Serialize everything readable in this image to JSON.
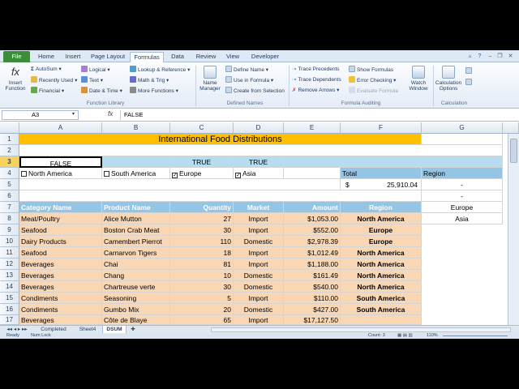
{
  "tabs": {
    "file": "File",
    "home": "Home",
    "insert": "Insert",
    "page_layout": "Page Layout",
    "formulas": "Formulas",
    "data": "Data",
    "review": "Review",
    "view": "View",
    "developer": "Developer"
  },
  "ribbon": {
    "insert_function": "Insert Function",
    "autosum": "AutoSum",
    "recently_used": "Recently Used",
    "financial": "Financial",
    "logical": "Logical",
    "text": "Text",
    "date_time": "Date & Time",
    "lookup_reference": "Lookup & Reference",
    "math_trig": "Math & Trig",
    "more_functions": "More Functions",
    "function_library": "Function Library",
    "name_manager": "Name Manager",
    "define_name": "Define Name",
    "use_in_formula": "Use in Formula",
    "create_from_selection": "Create from Selection",
    "defined_names": "Defined Names",
    "trace_precedents": "Trace Precedents",
    "trace_dependents": "Trace Dependents",
    "remove_arrows": "Remove Arrows",
    "show_formulas": "Show Formulas",
    "error_checking": "Error Checking",
    "evaluate_formula": "Evaluate Formula",
    "formula_auditing": "Formula Auditing",
    "watch_window": "Watch Window",
    "calculation_options": "Calculation Options",
    "calculation": "Calculation"
  },
  "formula_bar": {
    "name_box": "A3",
    "fx": "fx",
    "content": "FALSE"
  },
  "columns": [
    "A",
    "B",
    "C",
    "D",
    "E",
    "F",
    "G"
  ],
  "rows": [
    "1",
    "2",
    "3",
    "4",
    "5",
    "6",
    "7",
    "8",
    "9",
    "10",
    "11",
    "12",
    "13",
    "14",
    "15",
    "16",
    "17"
  ],
  "sheet": {
    "title": "International Food Distributions",
    "row3": {
      "a": "FALSE",
      "c": "TRUE",
      "d": "TRUE"
    },
    "checkboxes": [
      {
        "label": "North America",
        "checked": "",
        "checked_state": false
      },
      {
        "label": "South America",
        "checked": "",
        "checked_state": false
      },
      {
        "label": "Europe",
        "checked": "✓",
        "checked_state": true
      },
      {
        "label": "Asia",
        "checked": "✓",
        "checked_state": true
      }
    ],
    "total_label": "Total",
    "total_currency": "$",
    "total_value": "25,910.04",
    "region_label": "Region",
    "region_list": [
      "-",
      "-",
      "Europe",
      "Asia"
    ],
    "headers": {
      "category": "Category Name",
      "product": "Product Name",
      "quantity": "Quantity",
      "market": "Market",
      "amount": "Amount",
      "region": "Region"
    },
    "data_rows": [
      {
        "category": "Meat/Poultry",
        "product": "Alice Mutton",
        "quantity": "27",
        "market": "Import",
        "amount": "$1,053.00",
        "region": "North America"
      },
      {
        "category": "Seafood",
        "product": "Boston Crab Meat",
        "quantity": "30",
        "market": "Import",
        "amount": "$552.00",
        "region": "Europe"
      },
      {
        "category": "Dairy Products",
        "product": "Camembert Pierrot",
        "quantity": "110",
        "market": "Domestic",
        "amount": "$2,978.39",
        "region": "Europe"
      },
      {
        "category": "Seafood",
        "product": "Carnarvon Tigers",
        "quantity": "18",
        "market": "Import",
        "amount": "$1,012.49",
        "region": "North America"
      },
      {
        "category": "Beverages",
        "product": "Chai",
        "quantity": "81",
        "market": "Import",
        "amount": "$1,188.00",
        "region": "North America"
      },
      {
        "category": "Beverages",
        "product": "Chang",
        "quantity": "10",
        "market": "Domestic",
        "amount": "$161.49",
        "region": "North America"
      },
      {
        "category": "Beverages",
        "product": "Chartreuse verte",
        "quantity": "30",
        "market": "Domestic",
        "amount": "$540.00",
        "region": "North America"
      },
      {
        "category": "Condiments",
        "product": "Seasoning",
        "quantity": "5",
        "market": "Import",
        "amount": "$110.00",
        "region": "South America"
      },
      {
        "category": "Condiments",
        "product": "Gumbo Mix",
        "quantity": "20",
        "market": "Domestic",
        "amount": "$427.00",
        "region": "South America"
      }
    ],
    "partial_row": {
      "category": "Beverages",
      "product": "Côte de Blaye",
      "quantity": "65",
      "market": "Import",
      "amount": "$17,127.50",
      "region": ""
    }
  },
  "sheet_tabs": {
    "completed": "Completed",
    "sheet4": "Sheet4",
    "dsum": "DSUM"
  },
  "status": {
    "ready": "Ready",
    "num_lock": "Num Lock",
    "count": "Count: 3",
    "zoom": "110%"
  },
  "colors": {
    "orange": "#f9d7b5",
    "blue": "#95c5e4",
    "yellow": "#ffc000",
    "file_green": "#3c8c3c"
  }
}
